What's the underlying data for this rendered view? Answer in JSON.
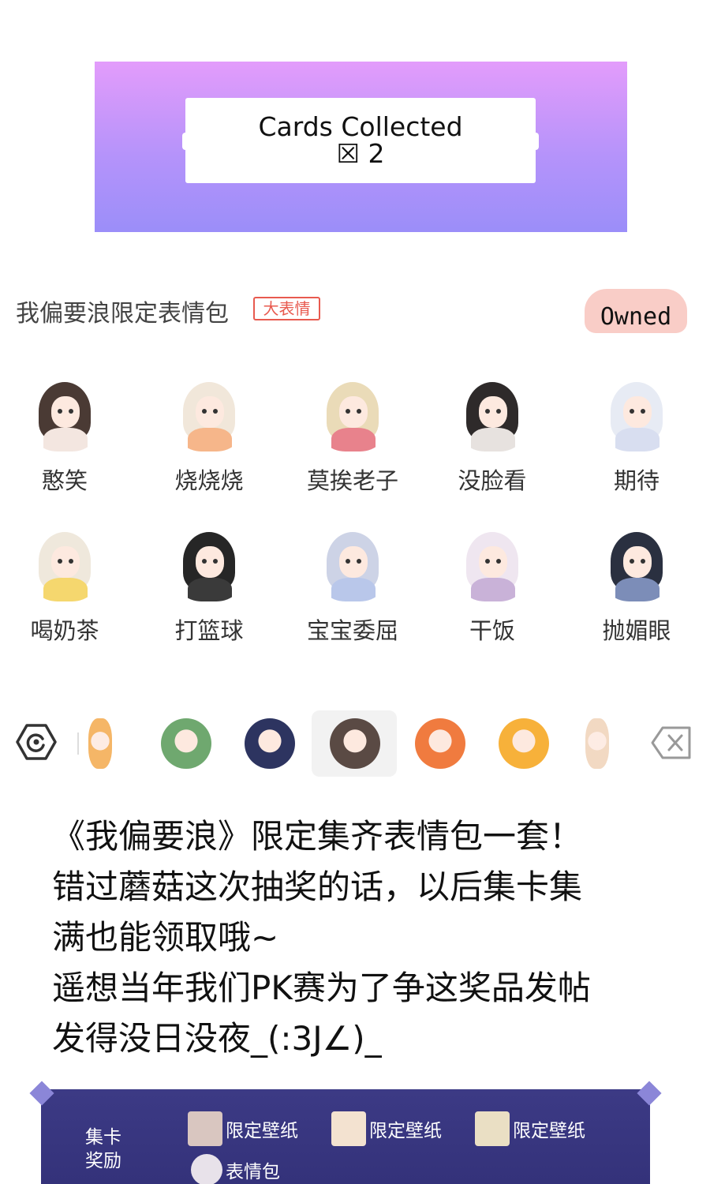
{
  "banner": {
    "line1": "Cards Collected",
    "line2": "☒ 2",
    "gradient_top": "#e39cfb",
    "gradient_bottom": "#9b8ef9"
  },
  "pack": {
    "title": "我偏要浪限定表情包",
    "tag": "大表情",
    "tag_color": "#e85a4f",
    "owned_label": "Owned",
    "owned_bg": "#f9cdc7"
  },
  "stickers": [
    {
      "label": "憨笑",
      "hair": "#4a3a34",
      "body": "#f3e6e0"
    },
    {
      "label": "烧烧烧",
      "hair": "#f1e7da",
      "body": "#f6b68a"
    },
    {
      "label": "莫挨老子",
      "hair": "#eadbb8",
      "body": "#e8828c"
    },
    {
      "label": "没脸看",
      "hair": "#2e2a2a",
      "body": "#e7e2df"
    },
    {
      "label": "期待",
      "hair": "#e7ebf4",
      "body": "#d8def0"
    },
    {
      "label": "喝奶茶",
      "hair": "#efe8dc",
      "body": "#f5d76e"
    },
    {
      "label": "打篮球",
      "hair": "#262626",
      "body": "#3a3a3a"
    },
    {
      "label": "宝宝委屈",
      "hair": "#cdd3e6",
      "body": "#b9c7ea"
    },
    {
      "label": "干饭",
      "hair": "#efe6f0",
      "body": "#c9b2d8"
    },
    {
      "label": "抛媚眼",
      "hair": "#2a3040",
      "body": "#7c8db8"
    }
  ],
  "emoji_bar": {
    "settings_icon": "hexagon-refresh-icon",
    "delete_icon": "backspace-icon",
    "thumbs": [
      {
        "name": "emoji-thumb-1",
        "color": "#f3a94c"
      },
      {
        "name": "emoji-thumb-2",
        "color": "#6fa86f"
      },
      {
        "name": "emoji-thumb-3",
        "color": "#2d3460"
      },
      {
        "name": "emoji-thumb-4",
        "color": "#5a4a44"
      },
      {
        "name": "emoji-thumb-5",
        "color": "#f07b3f"
      },
      {
        "name": "emoji-thumb-6",
        "color": "#f7b13a"
      },
      {
        "name": "emoji-thumb-7",
        "color": "#f0d2b8"
      }
    ]
  },
  "caption": {
    "lines": [
      "《我偏要浪》限定集齐表情包一套！",
      "错过蘑菇这次抽奖的话，以后集卡集",
      "满也能领取哦~",
      "遥想当年我们PK赛为了争这奖品发帖",
      "发得没日没夜_(:3J∠)_"
    ]
  },
  "reward": {
    "heading_line1": "集卡",
    "heading_line2": "奖励",
    "items": [
      {
        "label": "限定壁纸",
        "thumb": "#d9c6c0"
      },
      {
        "label": "限定壁纸",
        "thumb": "#f3e2d0"
      },
      {
        "label": "限定壁纸",
        "thumb": "#eadfc4"
      },
      {
        "label": "表情包",
        "thumb": "#e8e2ea"
      }
    ],
    "panel_color": "#3c3a85"
  }
}
